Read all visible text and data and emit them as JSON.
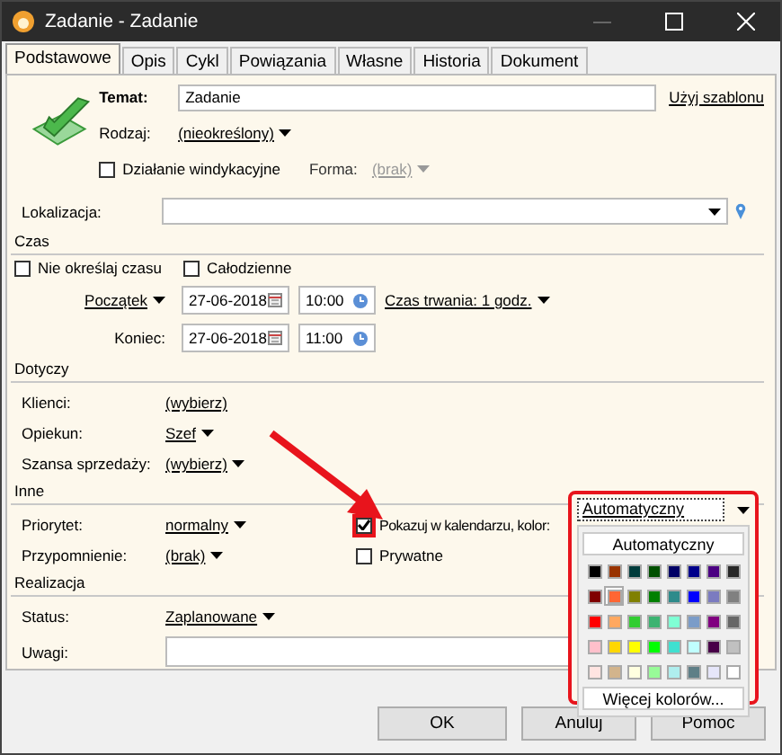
{
  "window": {
    "title": "Zadanie - Zadanie"
  },
  "tabs": [
    {
      "label": "Podstawowe",
      "selected": true
    },
    {
      "label": "Opis",
      "selected": false
    },
    {
      "label": "Cykl",
      "selected": false
    },
    {
      "label": "Powiązania",
      "selected": false
    },
    {
      "label": "Własne",
      "selected": false
    },
    {
      "label": "Historia",
      "selected": false
    },
    {
      "label": "Dokument",
      "selected": false
    }
  ],
  "header": {
    "subject_label": "Temat:",
    "subject_value": "Zadanie",
    "template_link": "Użyj szablonu",
    "type_label": "Rodzaj:",
    "type_value": "(nieokreślony)",
    "collection": {
      "label": "Działanie windykacyjne",
      "checked": false
    },
    "form_label": "Forma:",
    "form_value": "(brak)",
    "form_disabled": true
  },
  "location": {
    "label": "Lokalizacja:"
  },
  "time": {
    "title": "Czas",
    "no_time": {
      "label": "Nie określaj czasu",
      "checked": false
    },
    "all_day": {
      "label": "Całodzienne",
      "checked": false
    },
    "start_label": "Początek",
    "start_date": "27-06-2018",
    "start_time": "10:00",
    "duration": "Czas trwania: 1 godz.",
    "end_label": "Koniec:",
    "end_date": "27-06-2018",
    "end_time": "11:00"
  },
  "concerns": {
    "title": "Dotyczy",
    "rows": [
      {
        "label": "Klienci:",
        "value": "(wybierz)",
        "dropdown": false
      },
      {
        "label": "Opiekun:",
        "value": "Szef",
        "dropdown": true
      },
      {
        "label": "Szansa sprzedaży:",
        "value": "(wybierz)",
        "dropdown": true
      }
    ]
  },
  "other": {
    "title": "Inne",
    "priority": {
      "label": "Priorytet:",
      "value": "normalny"
    },
    "reminder": {
      "label": "Przypomnienie:",
      "value": "(brak)"
    },
    "show_in_calendar": {
      "label": "Pokazuj w kalendarzu, kolor:",
      "checked": true
    },
    "private": {
      "label": "Prywatne",
      "checked": false
    },
    "color_combo": {
      "value": "Automatyczny"
    }
  },
  "realization": {
    "title": "Realizacja",
    "status_label": "Status:",
    "status_value": "Zaplanowane",
    "notes_label": "Uwagi:"
  },
  "color_popup": {
    "auto_button": "Automatyczny",
    "more_button": "Więcej kolorów...",
    "swatches": [
      {
        "color": "#000000",
        "selected": false
      },
      {
        "color": "#993300",
        "selected": false
      },
      {
        "color": "#003c3c",
        "selected": false
      },
      {
        "color": "#005000",
        "selected": false
      },
      {
        "color": "#000066",
        "selected": false
      },
      {
        "color": "#00008b",
        "selected": false
      },
      {
        "color": "#4b0082",
        "selected": false
      },
      {
        "color": "#282828",
        "selected": false
      },
      {
        "color": "#800000",
        "selected": false
      },
      {
        "color": "#ff6633",
        "selected": true
      },
      {
        "color": "#808000",
        "selected": false
      },
      {
        "color": "#008000",
        "selected": false
      },
      {
        "color": "#2e8b8b",
        "selected": false
      },
      {
        "color": "#0000ff",
        "selected": false
      },
      {
        "color": "#7b7bc0",
        "selected": false
      },
      {
        "color": "#808080",
        "selected": false
      },
      {
        "color": "#ff0000",
        "selected": false
      },
      {
        "color": "#ffa860",
        "selected": false
      },
      {
        "color": "#32cd32",
        "selected": false
      },
      {
        "color": "#3cb371",
        "selected": false
      },
      {
        "color": "#7fffd4",
        "selected": false
      },
      {
        "color": "#7b9cc8",
        "selected": false
      },
      {
        "color": "#800080",
        "selected": false
      },
      {
        "color": "#666666",
        "selected": false
      },
      {
        "color": "#ffc0cb",
        "selected": false
      },
      {
        "color": "#ffd700",
        "selected": false
      },
      {
        "color": "#ffff00",
        "selected": false
      },
      {
        "color": "#00ff00",
        "selected": false
      },
      {
        "color": "#40e0d0",
        "selected": false
      },
      {
        "color": "#c0ffff",
        "selected": false
      },
      {
        "color": "#480048",
        "selected": false
      },
      {
        "color": "#c0c0c0",
        "selected": false
      },
      {
        "color": "#ffe4e1",
        "selected": false
      },
      {
        "color": "#d2b48c",
        "selected": false
      },
      {
        "color": "#ffffe0",
        "selected": false
      },
      {
        "color": "#98fb98",
        "selected": false
      },
      {
        "color": "#afeeee",
        "selected": false
      },
      {
        "color": "#5f7f87",
        "selected": false
      },
      {
        "color": "#e6e6fa",
        "selected": false
      },
      {
        "color": "#ffffff",
        "selected": false
      }
    ]
  },
  "buttons": [
    "OK",
    "Anuluj",
    "Pomoc"
  ]
}
